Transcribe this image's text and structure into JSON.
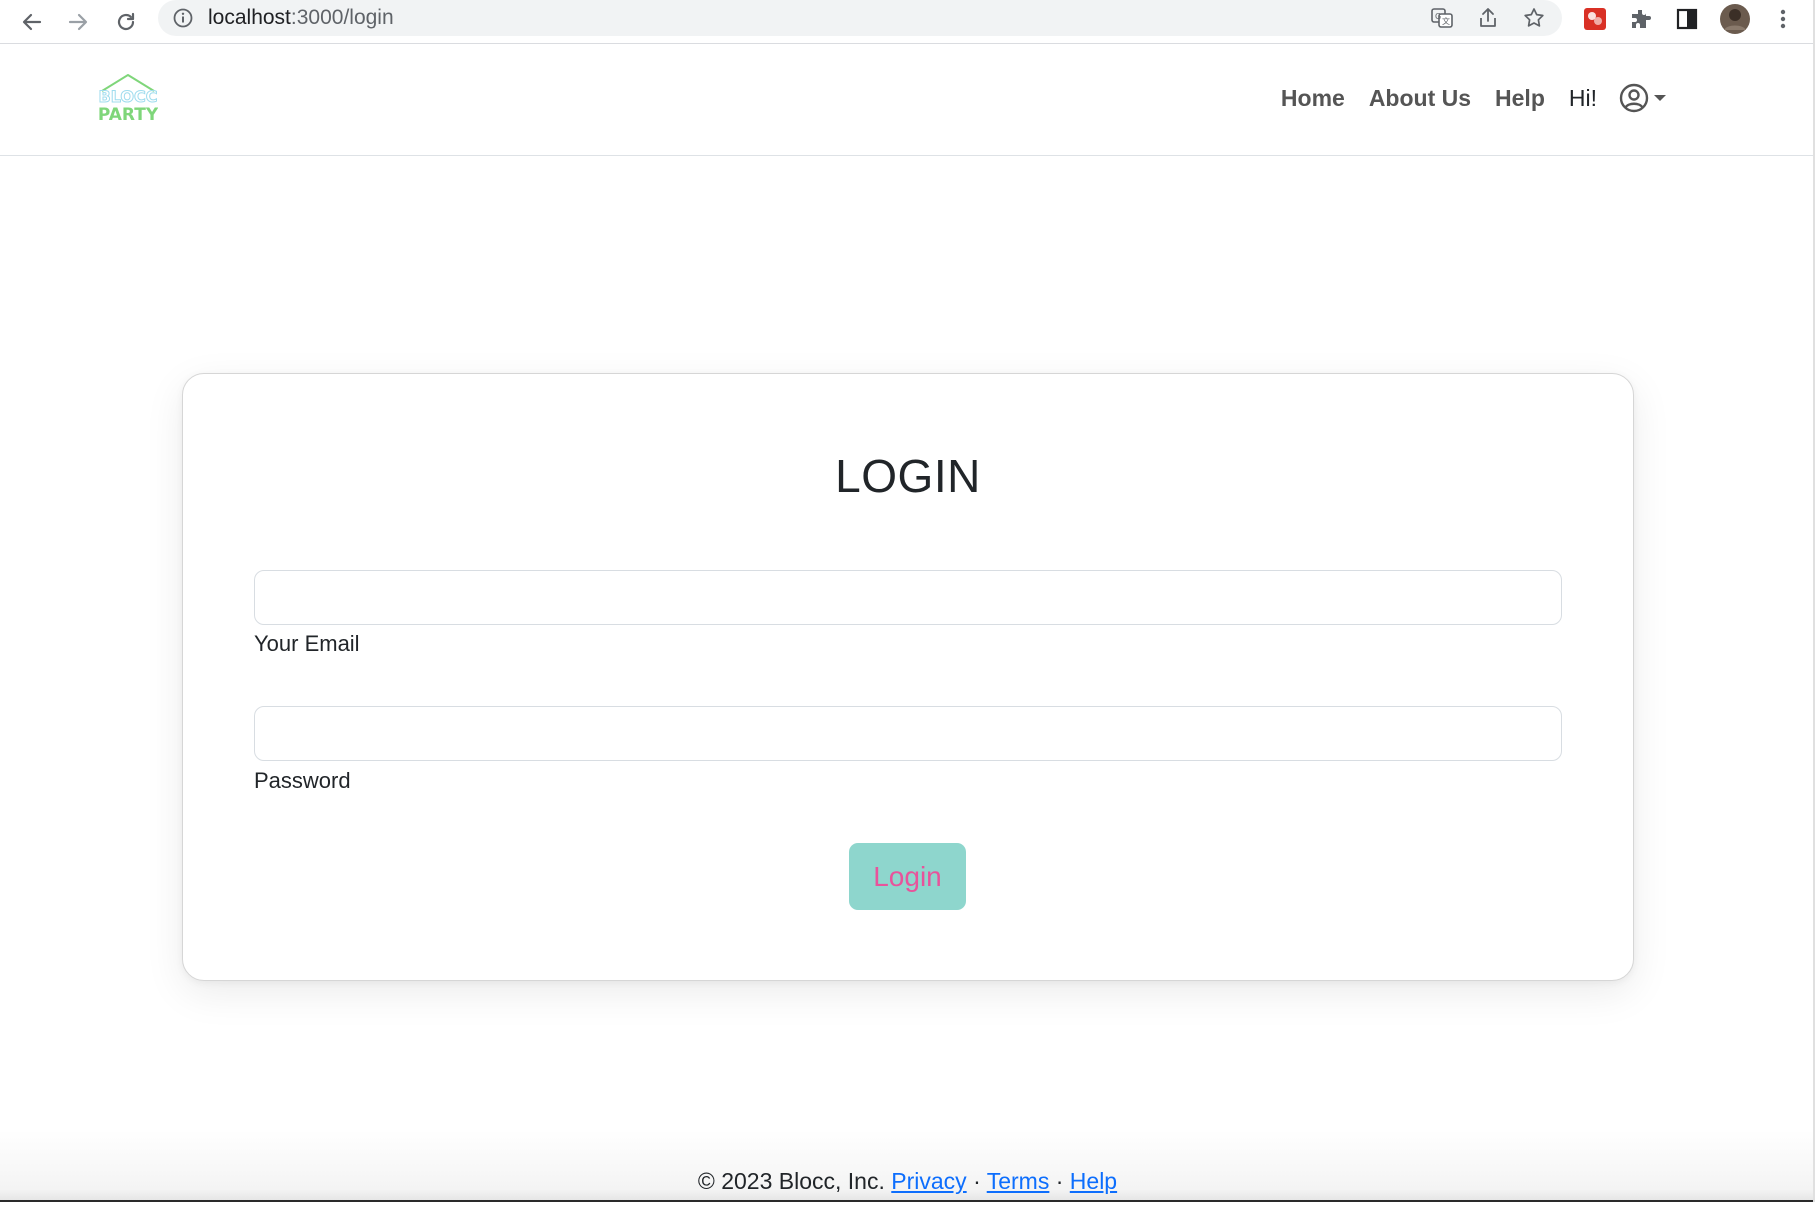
{
  "browser": {
    "url_host": "localhost",
    "url_path": ":3000/login",
    "icons": [
      "back-arrow-icon",
      "forward-arrow-icon",
      "reload-icon",
      "info-icon",
      "translate-icon",
      "share-icon",
      "bookmark-star-icon",
      "extension-icon",
      "puzzle-icon",
      "side-panel-icon",
      "profile-avatar",
      "more-menu-icon"
    ]
  },
  "navbar": {
    "logo_top": "BLOCC",
    "logo_bottom": "PARTY",
    "links": {
      "home": "Home",
      "about": "About Us",
      "help": "Help"
    },
    "greeting": "Hi!"
  },
  "login_card": {
    "title": "LOGIN",
    "email_label": "Your Email",
    "email_value": "",
    "password_label": "Password",
    "password_value": "",
    "submit_label": "Login"
  },
  "footer": {
    "copyright": "© 2023 Blocc, Inc.",
    "privacy": "Privacy",
    "terms": "Terms",
    "help": "Help",
    "separator": "·"
  },
  "colors": {
    "accent_teal": "#8ed6cd",
    "accent_pink": "#e8539b",
    "logo_green": "#7fd67a",
    "link_blue": "#0d6efd"
  }
}
